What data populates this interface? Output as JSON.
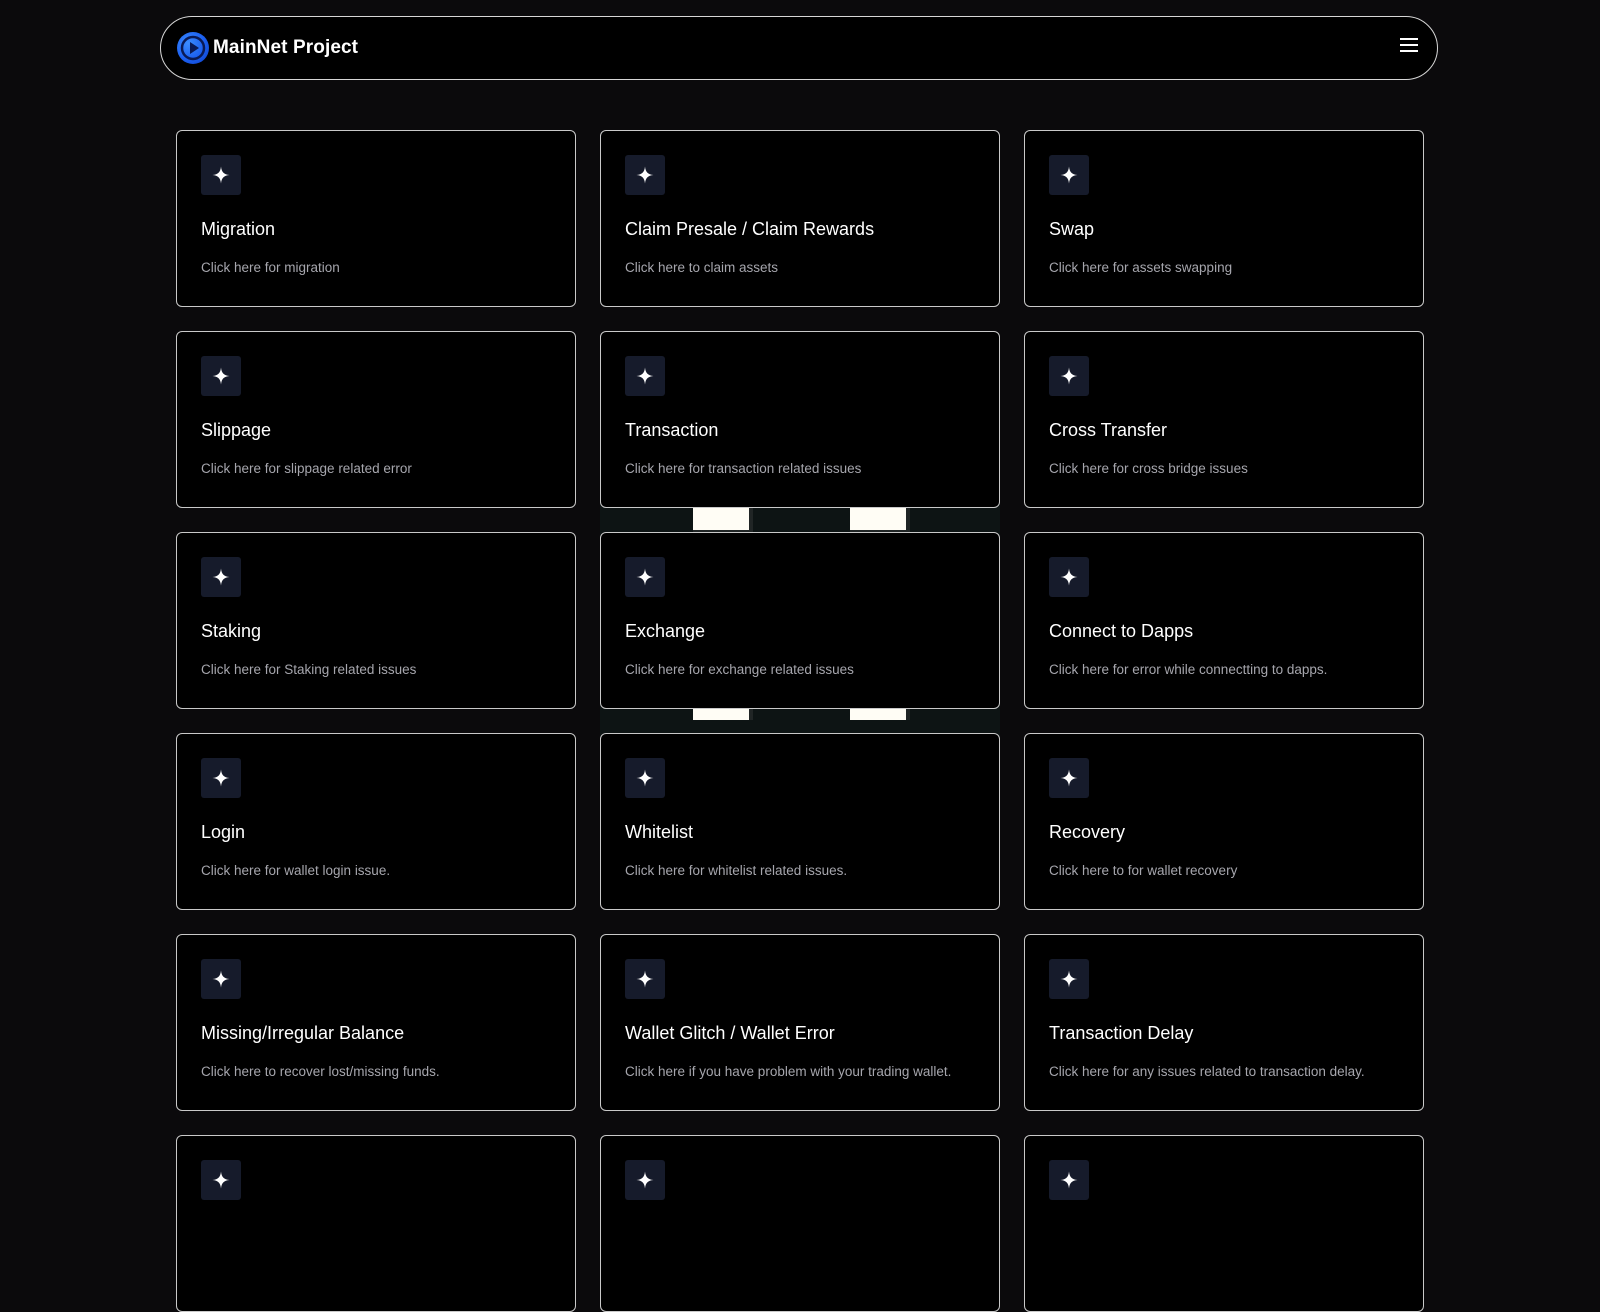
{
  "header": {
    "brand_name": "MainNet Project",
    "logo_color": "#1b5ff0"
  },
  "cards": [
    {
      "title": "Migration",
      "description": "Click here for migration",
      "icon": "sparkle-icon"
    },
    {
      "title": "Claim Presale / Claim Rewards",
      "description": "Click here to claim assets",
      "icon": "sparkle-icon"
    },
    {
      "title": "Swap",
      "description": "Click here for assets swapping",
      "icon": "sparkle-icon"
    },
    {
      "title": "Slippage",
      "description": "Click here for slippage related error",
      "icon": "sparkle-icon"
    },
    {
      "title": "Transaction",
      "description": "Click here for transaction related issues",
      "icon": "sparkle-icon"
    },
    {
      "title": "Cross Transfer",
      "description": "Click here for cross bridge issues",
      "icon": "sparkle-icon"
    },
    {
      "title": "Staking",
      "description": "Click here for Staking related issues",
      "icon": "sparkle-icon"
    },
    {
      "title": "Exchange",
      "description": "Click here for exchange related issues",
      "icon": "sparkle-icon"
    },
    {
      "title": "Connect to Dapps",
      "description": "Click here for error while connectting to dapps.",
      "icon": "sparkle-icon"
    },
    {
      "title": "Login",
      "description": "Click here for wallet login issue.",
      "icon": "sparkle-icon"
    },
    {
      "title": "Whitelist",
      "description": "Click here for whitelist related issues.",
      "icon": "sparkle-icon"
    },
    {
      "title": "Recovery",
      "description": "Click here to for wallet recovery",
      "icon": "sparkle-icon"
    },
    {
      "title": "Missing/Irregular Balance",
      "description": "Click here to recover lost/missing funds.",
      "icon": "sparkle-icon"
    },
    {
      "title": "Wallet Glitch / Wallet Error",
      "description": "Click here if you have problem with your trading wallet.",
      "icon": "sparkle-icon"
    },
    {
      "title": "Transaction Delay",
      "description": "Click here for any issues related to transaction delay.",
      "icon": "sparkle-icon"
    },
    {
      "title": "",
      "description": "",
      "icon": "sparkle-icon"
    },
    {
      "title": "",
      "description": "",
      "icon": "sparkle-icon"
    },
    {
      "title": "",
      "description": "",
      "icon": "sparkle-icon"
    }
  ],
  "colors": {
    "background": "#0b0a0c",
    "card_background": "#000000",
    "card_border": "#c9c9c9",
    "icon_box": "#161b2b",
    "description_text": "#a6a6ad"
  }
}
